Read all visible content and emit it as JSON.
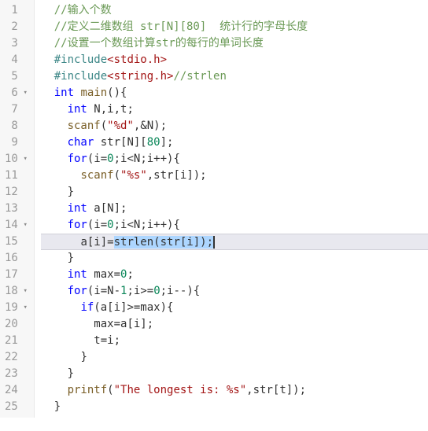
{
  "lines": [
    {
      "n": "1",
      "fold": "",
      "tokens": [
        {
          "t": "//输入个数",
          "c": "c-comment"
        }
      ],
      "indent": 1
    },
    {
      "n": "2",
      "fold": "",
      "tokens": [
        {
          "t": "//定义二维数组 str[N][80]  统计行的字母长度",
          "c": "c-comment"
        }
      ],
      "indent": 1
    },
    {
      "n": "3",
      "fold": "",
      "tokens": [
        {
          "t": "//设置一个数组计算str的每行的单词长度",
          "c": "c-comment"
        }
      ],
      "indent": 1
    },
    {
      "n": "4",
      "fold": "",
      "tokens": [
        {
          "t": "#include",
          "c": "c-header"
        },
        {
          "t": "<stdio.h>",
          "c": "c-angle"
        }
      ],
      "indent": 1
    },
    {
      "n": "5",
      "fold": "",
      "tokens": [
        {
          "t": "#include",
          "c": "c-header"
        },
        {
          "t": "<string.h>",
          "c": "c-angle"
        },
        {
          "t": "//strlen",
          "c": "c-comment"
        }
      ],
      "indent": 1
    },
    {
      "n": "6",
      "fold": "▾",
      "tokens": [
        {
          "t": "int",
          "c": "c-type"
        },
        {
          "t": " ",
          "c": ""
        },
        {
          "t": "main",
          "c": "c-func"
        },
        {
          "t": "(){",
          "c": "c-punc"
        }
      ],
      "indent": 1
    },
    {
      "n": "7",
      "fold": "",
      "tokens": [
        {
          "t": "int",
          "c": "c-type"
        },
        {
          "t": " N,i,t;",
          "c": "c-ident"
        }
      ],
      "indent": 2
    },
    {
      "n": "8",
      "fold": "",
      "tokens": [
        {
          "t": "scanf",
          "c": "c-func"
        },
        {
          "t": "(",
          "c": "c-punc"
        },
        {
          "t": "\"%d\"",
          "c": "c-string"
        },
        {
          "t": ",&N);",
          "c": "c-ident"
        }
      ],
      "indent": 2
    },
    {
      "n": "9",
      "fold": "",
      "tokens": [
        {
          "t": "char",
          "c": "c-type"
        },
        {
          "t": " str[N][",
          "c": "c-ident"
        },
        {
          "t": "80",
          "c": "c-number"
        },
        {
          "t": "];",
          "c": "c-ident"
        }
      ],
      "indent": 2
    },
    {
      "n": "10",
      "fold": "▾",
      "tokens": [
        {
          "t": "for",
          "c": "c-keyword"
        },
        {
          "t": "(i=",
          "c": "c-ident"
        },
        {
          "t": "0",
          "c": "c-number"
        },
        {
          "t": ";i<N;i++){",
          "c": "c-ident"
        }
      ],
      "indent": 2
    },
    {
      "n": "11",
      "fold": "",
      "tokens": [
        {
          "t": "scanf",
          "c": "c-func"
        },
        {
          "t": "(",
          "c": "c-punc"
        },
        {
          "t": "\"%s\"",
          "c": "c-string"
        },
        {
          "t": ",str[i]);",
          "c": "c-ident"
        }
      ],
      "indent": 3
    },
    {
      "n": "12",
      "fold": "",
      "tokens": [
        {
          "t": "}",
          "c": "c-punc"
        }
      ],
      "indent": 2
    },
    {
      "n": "13",
      "fold": "",
      "tokens": [
        {
          "t": "int",
          "c": "c-type"
        },
        {
          "t": " a[N];",
          "c": "c-ident"
        }
      ],
      "indent": 2
    },
    {
      "n": "14",
      "fold": "▾",
      "tokens": [
        {
          "t": "for",
          "c": "c-keyword"
        },
        {
          "t": "(i=",
          "c": "c-ident"
        },
        {
          "t": "0",
          "c": "c-number"
        },
        {
          "t": ";i<N;i++){",
          "c": "c-ident"
        }
      ],
      "indent": 2
    },
    {
      "n": "15",
      "fold": "",
      "tokens": [
        {
          "t": "a[i]=",
          "c": "c-ident"
        },
        {
          "t": "strlen(str[i]);",
          "c": "c-ident",
          "sel": true
        }
      ],
      "indent": 3,
      "hl": true,
      "cursor": true
    },
    {
      "n": "16",
      "fold": "",
      "tokens": [
        {
          "t": "}",
          "c": "c-punc"
        }
      ],
      "indent": 2
    },
    {
      "n": "17",
      "fold": "",
      "tokens": [
        {
          "t": "int",
          "c": "c-type"
        },
        {
          "t": " max=",
          "c": "c-ident"
        },
        {
          "t": "0",
          "c": "c-number"
        },
        {
          "t": ";",
          "c": "c-punc"
        }
      ],
      "indent": 2
    },
    {
      "n": "18",
      "fold": "▾",
      "tokens": [
        {
          "t": "for",
          "c": "c-keyword"
        },
        {
          "t": "(i=N-",
          "c": "c-ident"
        },
        {
          "t": "1",
          "c": "c-number"
        },
        {
          "t": ";i>=",
          "c": "c-ident"
        },
        {
          "t": "0",
          "c": "c-number"
        },
        {
          "t": ";i--){",
          "c": "c-ident"
        }
      ],
      "indent": 2
    },
    {
      "n": "19",
      "fold": "▾",
      "tokens": [
        {
          "t": "if",
          "c": "c-keyword"
        },
        {
          "t": "(a[i]>=max){",
          "c": "c-ident"
        }
      ],
      "indent": 3
    },
    {
      "n": "20",
      "fold": "",
      "tokens": [
        {
          "t": "max=a[i];",
          "c": "c-ident"
        }
      ],
      "indent": 4
    },
    {
      "n": "21",
      "fold": "",
      "tokens": [
        {
          "t": "t=i;",
          "c": "c-ident"
        }
      ],
      "indent": 4
    },
    {
      "n": "22",
      "fold": "",
      "tokens": [
        {
          "t": "}",
          "c": "c-punc"
        }
      ],
      "indent": 3
    },
    {
      "n": "23",
      "fold": "",
      "tokens": [
        {
          "t": "}",
          "c": "c-punc"
        }
      ],
      "indent": 2
    },
    {
      "n": "24",
      "fold": "",
      "tokens": [
        {
          "t": "printf",
          "c": "c-func"
        },
        {
          "t": "(",
          "c": "c-punc"
        },
        {
          "t": "\"The longest is: %s\"",
          "c": "c-string"
        },
        {
          "t": ",str[t]);",
          "c": "c-ident"
        }
      ],
      "indent": 2
    },
    {
      "n": "25",
      "fold": "",
      "tokens": [
        {
          "t": "}",
          "c": "c-punc"
        }
      ],
      "indent": 1
    }
  ],
  "indent_unit": "  "
}
